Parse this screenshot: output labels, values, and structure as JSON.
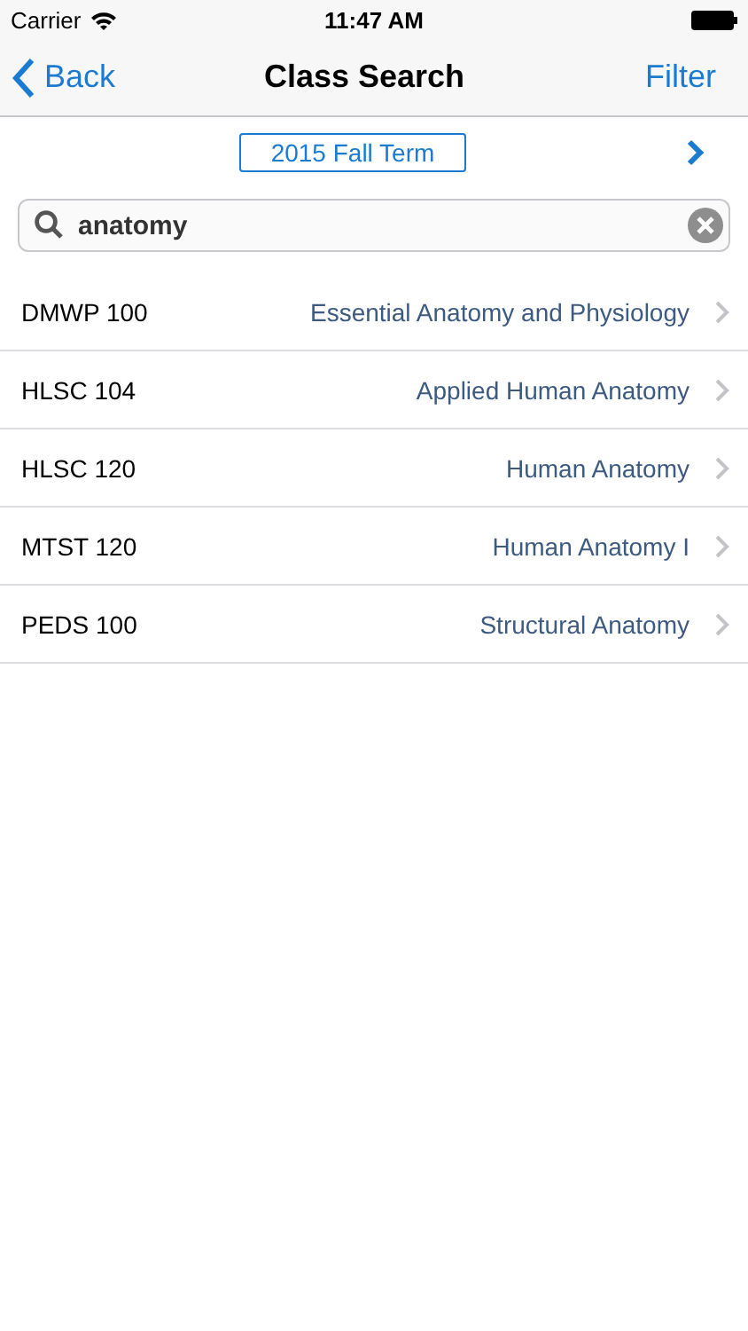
{
  "status_bar": {
    "carrier": "Carrier",
    "time": "11:47 AM"
  },
  "nav_bar": {
    "back": "Back",
    "title": "Class Search",
    "action": "Filter"
  },
  "term": {
    "label": "2015 Fall Term"
  },
  "search": {
    "value": "anatomy"
  },
  "results": [
    {
      "code": "DMWP 100",
      "title": "Essential Anatomy and Physiology"
    },
    {
      "code": "HLSC 104",
      "title": "Applied Human Anatomy"
    },
    {
      "code": "HLSC 120",
      "title": "Human Anatomy"
    },
    {
      "code": "MTST 120",
      "title": "Human Anatomy I"
    },
    {
      "code": "PEDS 100",
      "title": "Structural Anatomy"
    }
  ]
}
